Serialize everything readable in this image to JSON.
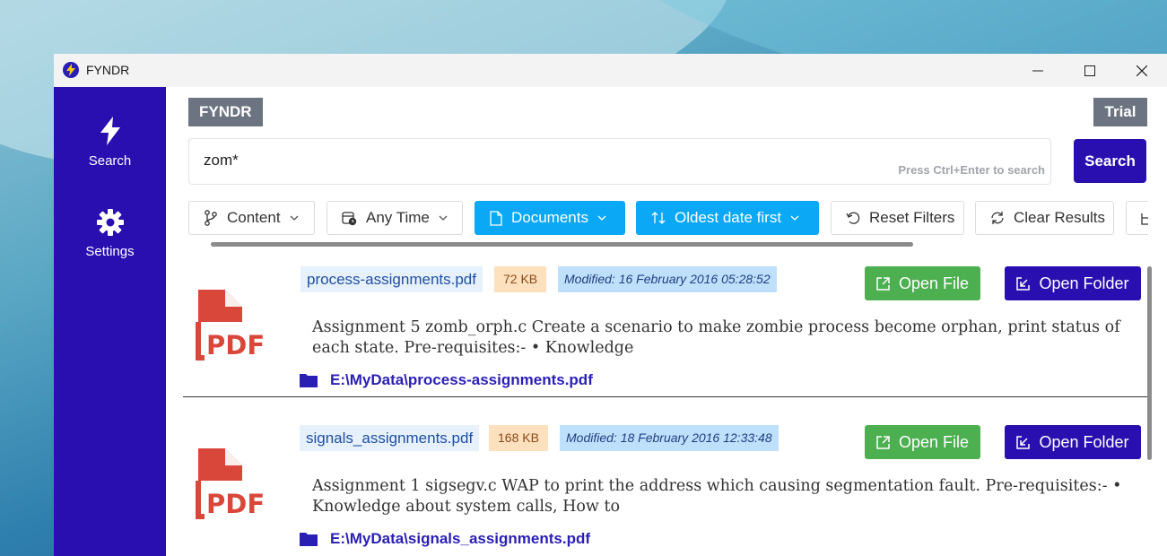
{
  "window": {
    "title": "FYNDR"
  },
  "sidebar": {
    "items": [
      {
        "label": "Search",
        "icon": "bolt-icon"
      },
      {
        "label": "Settings",
        "icon": "gear-icon"
      }
    ]
  },
  "header": {
    "brand": "FYNDR",
    "license": "Trial"
  },
  "search": {
    "value": "zom*",
    "hint": "Press Ctrl+Enter to search",
    "button_label": "Search"
  },
  "filters": {
    "content": "Content",
    "time": "Any Time",
    "type": "Documents",
    "sort": "Oldest date first",
    "reset": "Reset Filters",
    "clear": "Clear Results"
  },
  "results": [
    {
      "name": "process-assignments.pdf",
      "size": "72 KB",
      "modified": "Modified:  16 February 2016 05:28:52",
      "snippet": "Assignment 5 zomb_orph.c Create a scenario to make zombie process become orphan, print status of each state. Pre-requisites:- • Knowledge",
      "path": "E:\\MyData\\process-assignments.pdf",
      "open_file": "Open File",
      "open_folder": "Open Folder"
    },
    {
      "name": "signals_assignments.pdf",
      "size": "168 KB",
      "modified": "Modified:  18 February 2016 12:33:48",
      "snippet": "Assignment 1 sigsegv.c WAP to print the address which causing segmentation fault. Pre-requisites:- • Knowledge about system calls, How to",
      "path": "E:\\MyData\\signals_assignments.pdf",
      "open_file": "Open File",
      "open_folder": "Open Folder"
    }
  ],
  "colors": {
    "brand": "#2a0fb0",
    "accent": "#0aa8f5",
    "open_file": "#4caf50",
    "pdf": "#d9473b"
  }
}
